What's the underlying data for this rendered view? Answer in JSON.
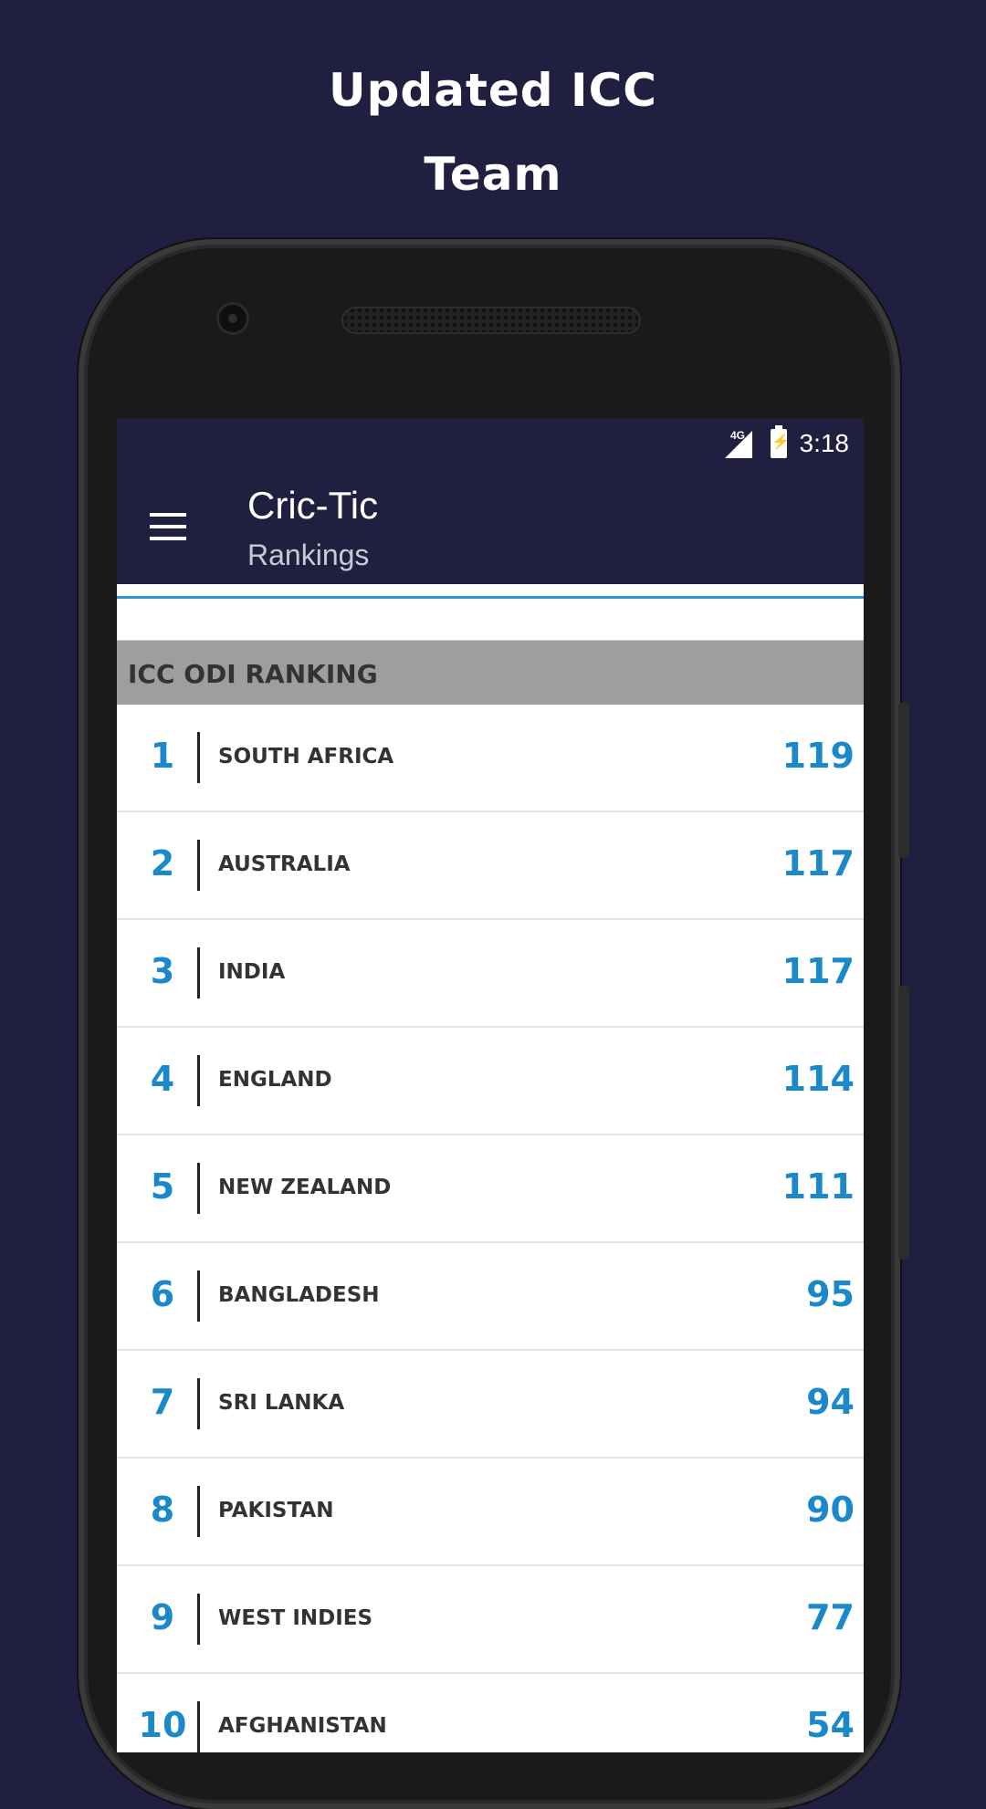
{
  "promo": {
    "line1": "Updated ICC",
    "line2": "Team"
  },
  "status_bar": {
    "network": "4G",
    "time": "3:18"
  },
  "app_bar": {
    "title": "Cric-Tic",
    "subtitle": "Rankings",
    "menu_icon": "hamburger-menu-icon"
  },
  "section": {
    "title": "ICC ODI RANKING"
  },
  "rankings": [
    {
      "rank": "1",
      "team": "SOUTH AFRICA",
      "points": "119"
    },
    {
      "rank": "2",
      "team": "AUSTRALIA",
      "points": "117"
    },
    {
      "rank": "3",
      "team": "INDIA",
      "points": "117"
    },
    {
      "rank": "4",
      "team": "ENGLAND",
      "points": "114"
    },
    {
      "rank": "5",
      "team": "NEW ZEALAND",
      "points": "111"
    },
    {
      "rank": "6",
      "team": "BANGLADESH",
      "points": "95"
    },
    {
      "rank": "7",
      "team": "SRI LANKA",
      "points": "94"
    },
    {
      "rank": "8",
      "team": "PAKISTAN",
      "points": "90"
    },
    {
      "rank": "9",
      "team": "WEST INDIES",
      "points": "77"
    },
    {
      "rank": "10",
      "team": "AFGHANISTAN",
      "points": "54"
    }
  ],
  "colors": {
    "background": "#201f3f",
    "accent": "#1a88c9",
    "section_header": "#9e9e9e"
  }
}
